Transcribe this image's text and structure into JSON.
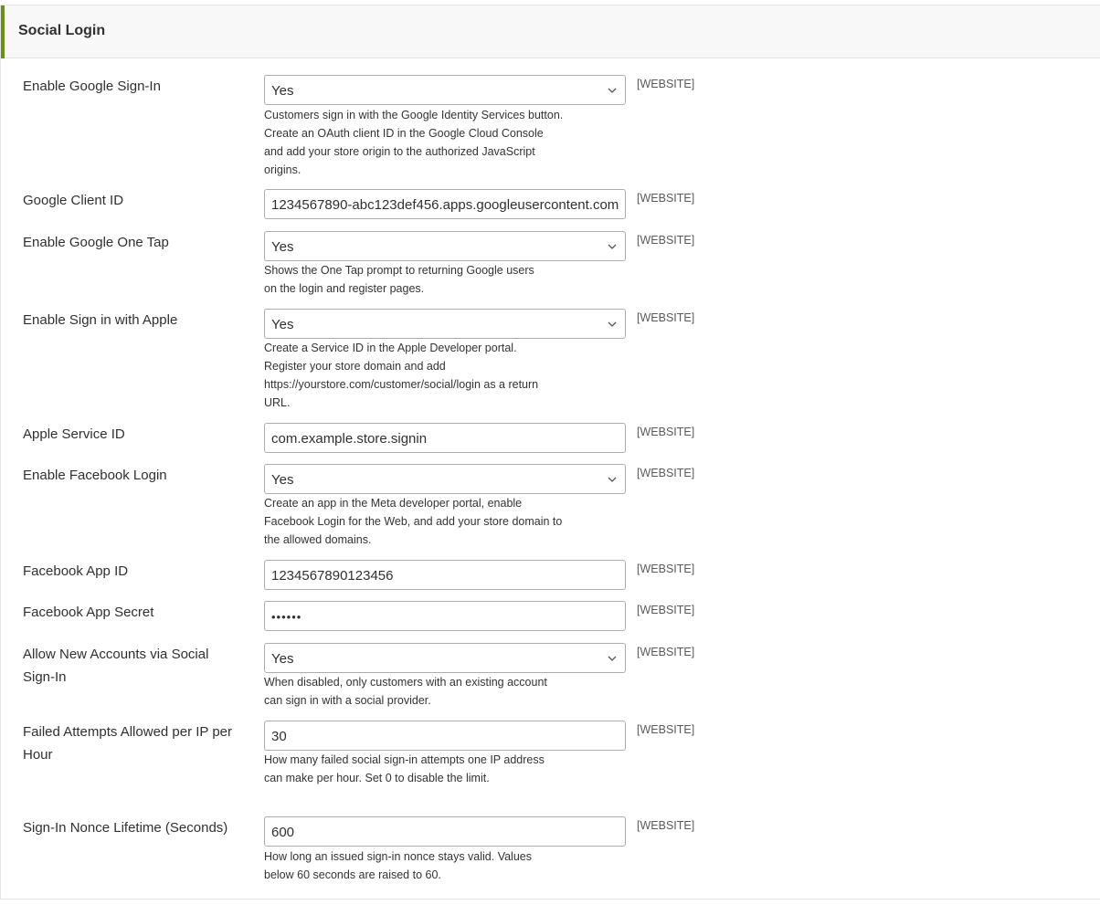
{
  "section": {
    "title": "Social Login",
    "accent_color": "#6b8f1a"
  },
  "scope_label": "[WEBSITE]",
  "fields": {
    "enable_google": {
      "label": "Enable Google Sign-In",
      "value": "Yes",
      "note": "Customers sign in with the Google Identity Services button. Create an OAuth client ID in the Google Cloud Console and add your store origin to the authorized JavaScript origins."
    },
    "google_client_id": {
      "label": "Google Client ID",
      "value": "1234567890-abc123def456.apps.googleusercontent.com"
    },
    "enable_one_tap": {
      "label": "Enable Google One Tap",
      "value": "Yes",
      "note": "Shows the One Tap prompt to returning Google users on the login and register pages."
    },
    "enable_apple": {
      "label": "Enable Sign in with Apple",
      "value": "Yes",
      "note": "Create a Service ID in the Apple Developer portal. Register your store domain and add https://yourstore.com/customer/social/login as a return URL."
    },
    "apple_service_id": {
      "label": "Apple Service ID",
      "value": "com.example.store.signin"
    },
    "enable_facebook": {
      "label": "Enable Facebook Login",
      "value": "Yes",
      "note": "Create an app in the Meta developer portal, enable Facebook Login for the Web, and add your store domain to the allowed domains."
    },
    "facebook_app_id": {
      "label": "Facebook App ID",
      "value": "1234567890123456"
    },
    "facebook_app_secret": {
      "label": "Facebook App Secret",
      "value": "••••••"
    },
    "allow_new_accounts": {
      "label": "Allow New Accounts via Social Sign-In",
      "value": "Yes",
      "note": "When disabled, only customers with an existing account can sign in with a social provider."
    },
    "failed_attempts": {
      "label": "Failed Attempts Allowed per IP per Hour",
      "value": "30",
      "note": "How many failed social sign-in attempts one IP address can make per hour. Set 0 to disable the limit."
    },
    "nonce_lifetime": {
      "label": "Sign-In Nonce Lifetime (Seconds)",
      "value": "600",
      "note": "How long an issued sign-in nonce stays valid. Values below 60 seconds are raised to 60."
    }
  }
}
